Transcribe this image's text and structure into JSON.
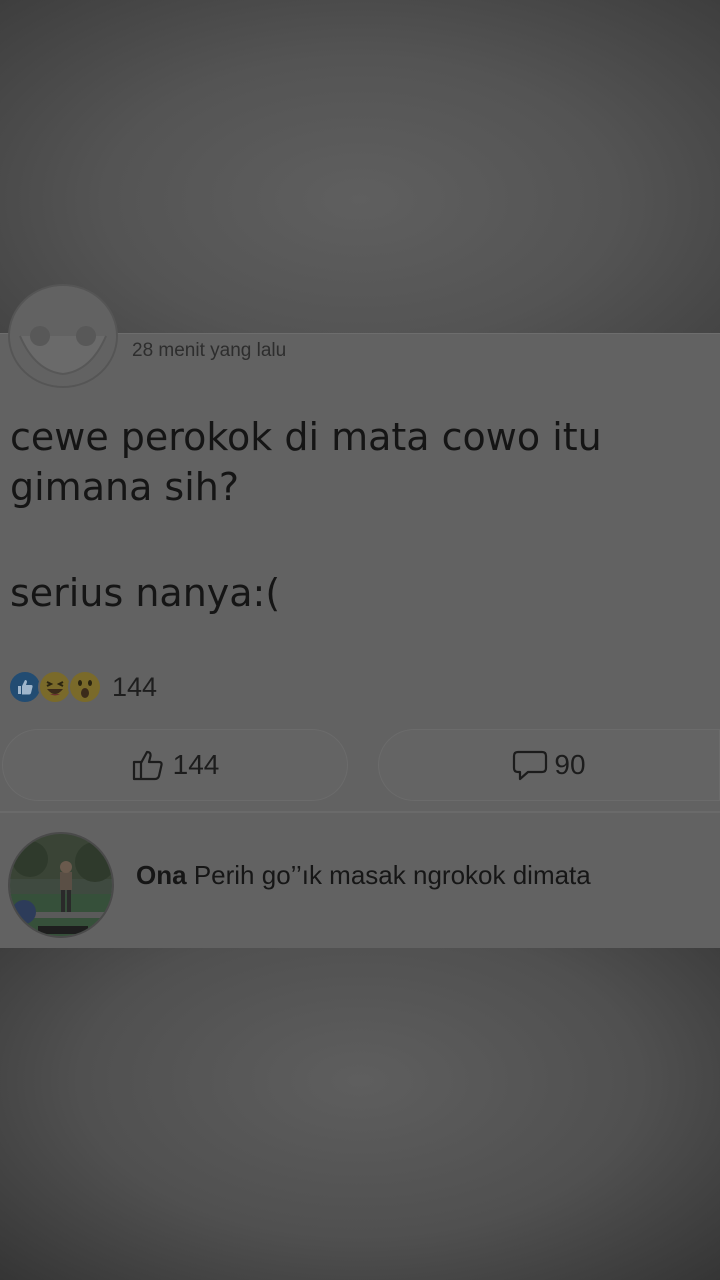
{
  "post": {
    "timestamp": "28 menit yang lalu",
    "text_lines": [
      "cewe perokok di mata cowo itu",
      "gimana sih?",
      "serius nanya:("
    ],
    "reactions": {
      "icons": [
        "like-icon",
        "haha-icon",
        "wow-icon"
      ],
      "count": "144"
    },
    "actions": {
      "like_count": "144",
      "comment_count": "90"
    }
  },
  "comment": {
    "author": "Ona",
    "text": "Perih go’’ık masak ngrokok dimata"
  },
  "colors": {
    "like_blue": "#224c72",
    "emoji_yellow": "#7a6a2a",
    "text_dark": "#151515"
  }
}
